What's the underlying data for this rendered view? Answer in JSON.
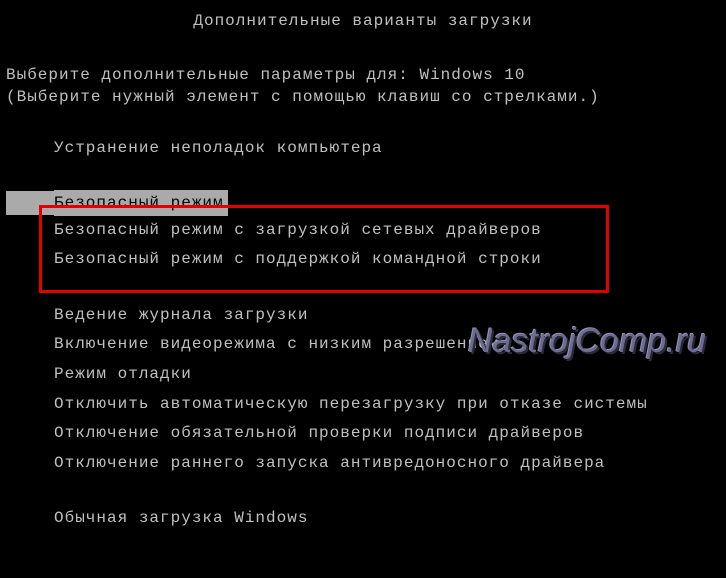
{
  "title": "Дополнительные варианты загрузки",
  "prompt": {
    "prefix": "Выберите дополнительные параметры для: ",
    "os": "Windows 10"
  },
  "instruction": "(Выберите нужный элемент с помощью клавиш со стрелками.)",
  "menu": {
    "group1": [
      "Устранение неполадок компьютера"
    ],
    "group2_selected": "Безопасный режим",
    "group2_rest": [
      "Безопасный режим с загрузкой сетевых драйверов",
      "Безопасный режим с поддержкой командной строки"
    ],
    "group3": [
      "Ведение журнала загрузки",
      "Включение видеорежима с низким разрешением",
      "Режим отладки",
      "Отключить автоматическую перезагрузку при отказе системы",
      "Отключение обязательной проверки подписи драйверов",
      "Отключение раннего запуска антивредоносного драйвера"
    ],
    "group4": [
      "Обычная загрузка Windows"
    ]
  },
  "watermark": "NastrojComp.ru"
}
